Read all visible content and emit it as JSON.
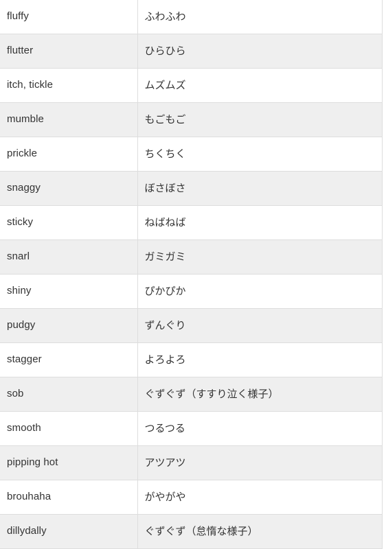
{
  "table": {
    "columns": [
      "english",
      "japanese"
    ],
    "rows": [
      {
        "english": "fluffy",
        "japanese": "ふわふわ"
      },
      {
        "english": "flutter",
        "japanese": "ひらひら"
      },
      {
        "english": "itch, tickle",
        "japanese": "ムズムズ"
      },
      {
        "english": "mumble",
        "japanese": "もごもご"
      },
      {
        "english": "prickle",
        "japanese": "ちくちく"
      },
      {
        "english": "snaggy",
        "japanese": "ぼさぼさ"
      },
      {
        "english": "sticky",
        "japanese": "ねばねば"
      },
      {
        "english": "snarl",
        "japanese": "ガミガミ"
      },
      {
        "english": "shiny",
        "japanese": "ぴかぴか"
      },
      {
        "english": "pudgy",
        "japanese": "ずんぐり"
      },
      {
        "english": "stagger",
        "japanese": "よろよろ"
      },
      {
        "english": "sob",
        "japanese": "ぐずぐず（すすり泣く様子）"
      },
      {
        "english": "smooth",
        "japanese": "つるつる"
      },
      {
        "english": "pipping hot",
        "japanese": "アツアツ"
      },
      {
        "english": "brouhaha",
        "japanese": "がやがや"
      },
      {
        "english": "dillydally",
        "japanese": "ぐずぐず（怠惰な様子）"
      }
    ]
  },
  "colors": {
    "border": "#dddddd",
    "row_alt_background": "#efefef",
    "row_background": "#ffffff",
    "text": "#333333"
  }
}
